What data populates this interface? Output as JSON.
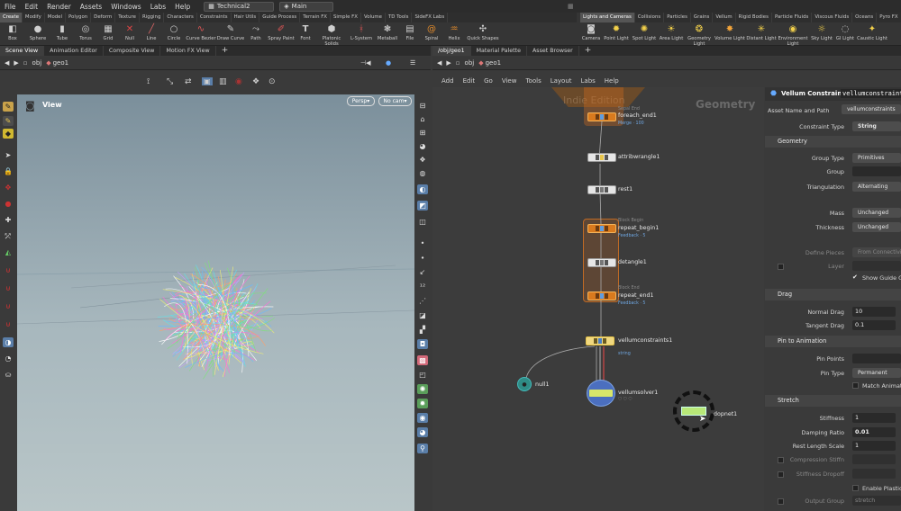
{
  "menubar": {
    "items": [
      "File",
      "Edit",
      "Render",
      "Assets",
      "Windows",
      "Labs",
      "Help"
    ],
    "desktop": "Technical2",
    "context": "Main"
  },
  "shelf_left": {
    "tabs": [
      "Create",
      "Modify",
      "Model",
      "Polygon",
      "Deform",
      "Texture",
      "Rigging",
      "Characters",
      "Constraints",
      "Hair Utils",
      "Guide Process",
      "Terrain FX",
      "Simple FX",
      "Volume",
      "TD Tools",
      "SideFX Labs"
    ],
    "tools": [
      "Box",
      "Sphere",
      "Tube",
      "Torus",
      "Grid",
      "Null",
      "Line",
      "Circle",
      "Curve Bezier",
      "Draw Curve",
      "Path",
      "Spray Paint",
      "Font",
      "Platonic Solids",
      "L-System",
      "Metaball",
      "File",
      "Spiral",
      "Helix",
      "Quick Shapes"
    ]
  },
  "shelf_right": {
    "tabs": [
      "Lights and Cameras",
      "Collisions",
      "Particles",
      "Grains",
      "Vellum",
      "Rigid Bodies",
      "Particle Fluids",
      "Viscous Fluids",
      "Oceans",
      "Pyro FX"
    ],
    "tools": [
      "Camera",
      "Point Light",
      "Spot Light",
      "Area Light",
      "Geometry Light",
      "Volume Light",
      "Distant Light",
      "Environment Light",
      "Sky Light",
      "GI Light",
      "Caustic Light"
    ]
  },
  "left_pane": {
    "tabs": [
      "Scene View",
      "Animation Editor",
      "Composite View",
      "Motion FX View"
    ],
    "path": [
      "obj",
      "geo1"
    ],
    "viewport_label": "View",
    "persp": "Persp",
    "cam": "No cam"
  },
  "right_pane": {
    "tabs": [
      "/obj/geo1",
      "Material Palette",
      "Asset Browser"
    ],
    "path": [
      "obj",
      "geo1"
    ],
    "menu": [
      "Add",
      "Edit",
      "Go",
      "View",
      "Tools",
      "Layout",
      "Labs",
      "Help"
    ],
    "context_label": "Geometry",
    "watermark": "Indie Edition"
  },
  "nodes": {
    "foreach_end1": {
      "name": "foreach_end1",
      "tag": "Sepal End",
      "sub": "Merge · 100"
    },
    "attribwrangle1": {
      "name": "attribwrangle1"
    },
    "rest1": {
      "name": "rest1"
    },
    "repeat_begin1": {
      "name": "repeat_begin1",
      "tag": "Block Begin",
      "sub": "Feedback · 5"
    },
    "detangle1": {
      "name": "detangle1"
    },
    "repeat_end1": {
      "name": "repeat_end1",
      "tag": "Block End",
      "sub": "Feedback · 5"
    },
    "vellumconstraints1": {
      "name": "vellumconstraints1",
      "sub": "string"
    },
    "null1": {
      "name": "null1"
    },
    "vellumsolver1": {
      "name": "vellumsolver1"
    },
    "dopnet1": {
      "name": "dopnet1"
    }
  },
  "params": {
    "title": "Vellum Constraints",
    "node_name": "vellumconstraints",
    "asset_label": "Asset Name and Path",
    "asset_value": "vellumconstraints",
    "constraint_type_label": "Constraint Type",
    "constraint_type": "String",
    "geometry_section": "Geometry",
    "group_type_label": "Group Type",
    "group_type": "Primitives",
    "group_label": "Group",
    "triangulation_label": "Triangulation",
    "triangulation": "Alternating",
    "mass_label": "Mass",
    "mass": "Unchanged",
    "thickness_label": "Thickness",
    "thickness": "Unchanged",
    "define_pieces_label": "Define Pieces",
    "define_pieces": "From Connectivity",
    "layer_label": "Layer",
    "show_guide": "Show Guide G",
    "drag_section": "Drag",
    "normal_drag_label": "Normal Drag",
    "normal_drag": "10",
    "tangent_drag_label": "Tangent Drag",
    "tangent_drag": "0.1",
    "pin_section": "Pin to Animation",
    "pin_points_label": "Pin Points",
    "pin_type_label": "Pin Type",
    "pin_type": "Permanent",
    "match_animation": "Match Animati",
    "stretch_section": "Stretch",
    "stiffness_label": "Stiffness",
    "stiffness": "1",
    "damping_label": "Damping Ratio",
    "damping": "0.01",
    "rest_length_label": "Rest Length Scale",
    "rest_length": "1",
    "compression_label": "Compression Stiffn",
    "dropoff_label": "Stiffness Dropoff",
    "enable_plasticity": "Enable Plastic",
    "output_group_label": "Output Group",
    "output_group": "stretch"
  },
  "colors": {
    "accent_orange": "#e07b1e",
    "node_yellow": "#e8c54a",
    "vellum_blue": "#4b7fc4",
    "null_teal": "#2f8c86",
    "sub_blue": "#6fa6e0"
  }
}
